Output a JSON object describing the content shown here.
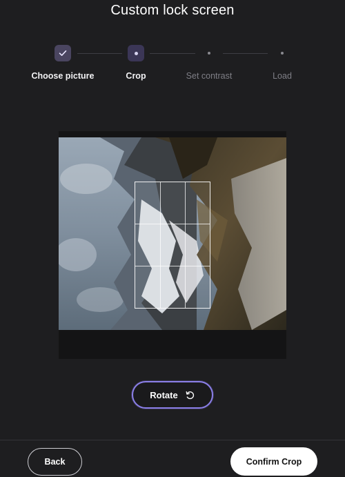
{
  "header": {
    "title": "Custom lock screen"
  },
  "stepper": {
    "steps": [
      {
        "label": "Choose picture",
        "state": "done"
      },
      {
        "label": "Crop",
        "state": "active"
      },
      {
        "label": "Set contrast",
        "state": "pending"
      },
      {
        "label": "Load",
        "state": "pending"
      }
    ],
    "icons": {
      "done": "check-icon",
      "active": "dot-icon",
      "pending": "dot-icon"
    }
  },
  "crop": {
    "image": "rotated mountain landscape photo",
    "grid": "3x3 crop overlay"
  },
  "actions": {
    "rotate_label": "Rotate",
    "rotate_icon": "rotate-icon",
    "back_label": "Back",
    "confirm_label": "Confirm Crop"
  },
  "colors": {
    "background": "#1e1e20",
    "accent": "#8b7fe8",
    "step_done": "#4a4560",
    "step_active": "#3b3656"
  }
}
